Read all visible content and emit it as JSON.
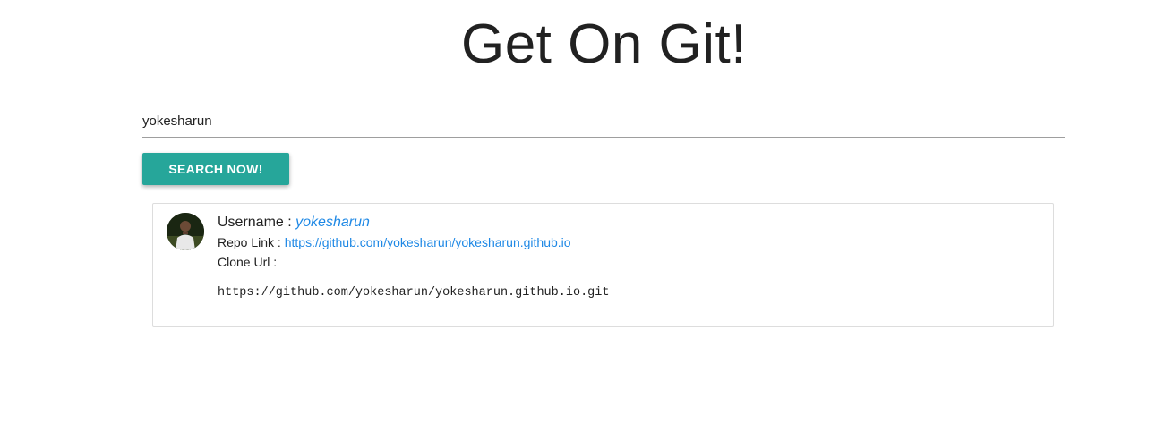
{
  "header": {
    "title": "Get On Git!"
  },
  "search": {
    "value": "yokesharun",
    "button_label": "SEARCH NOW!"
  },
  "result": {
    "username_label": "Username :",
    "username": "yokesharun",
    "repo_label": "Repo Link :",
    "repo_link": "https://github.com/yokesharun/yokesharun.github.io",
    "clone_label": "Clone Url :",
    "clone_url": "https://github.com/yokesharun/yokesharun.github.io.git"
  },
  "colors": {
    "accent": "#26a69a",
    "link": "#1e88e5"
  }
}
